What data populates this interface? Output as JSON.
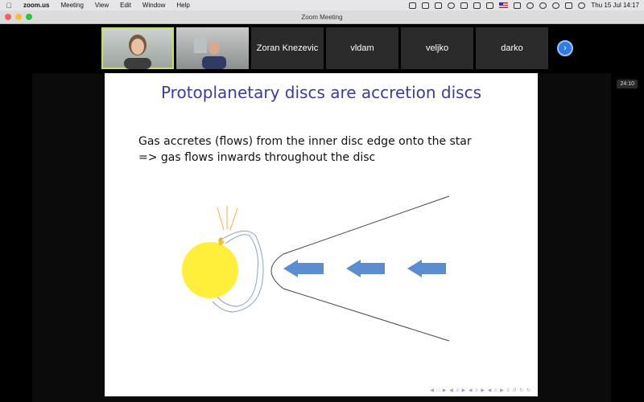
{
  "menubar": {
    "app": "zoom.us",
    "items": [
      "Meeting",
      "View",
      "Edit",
      "Window",
      "Help"
    ],
    "clock": "Thu 15 Jul  14:17"
  },
  "window": {
    "title": "Zoom Meeting",
    "colors": {
      "close": "#fe5f57",
      "minimize": "#febc2e",
      "zoom": "#28c840"
    }
  },
  "gallery": {
    "participants": [
      "Zoran Knezevic",
      "vldam",
      "veljko",
      "darko"
    ]
  },
  "timer": "24:10",
  "slide": {
    "title": "Protoplanetary discs are accretion discs",
    "line1": "Gas accretes (flows) from the inner disc edge onto the star",
    "line2": "=> gas flows inwards throughout the disc",
    "colors": {
      "title": "#3a3ca0",
      "star": "#ffef3a",
      "arrows": "#5b8dd1",
      "rays": "#f0b040"
    }
  }
}
